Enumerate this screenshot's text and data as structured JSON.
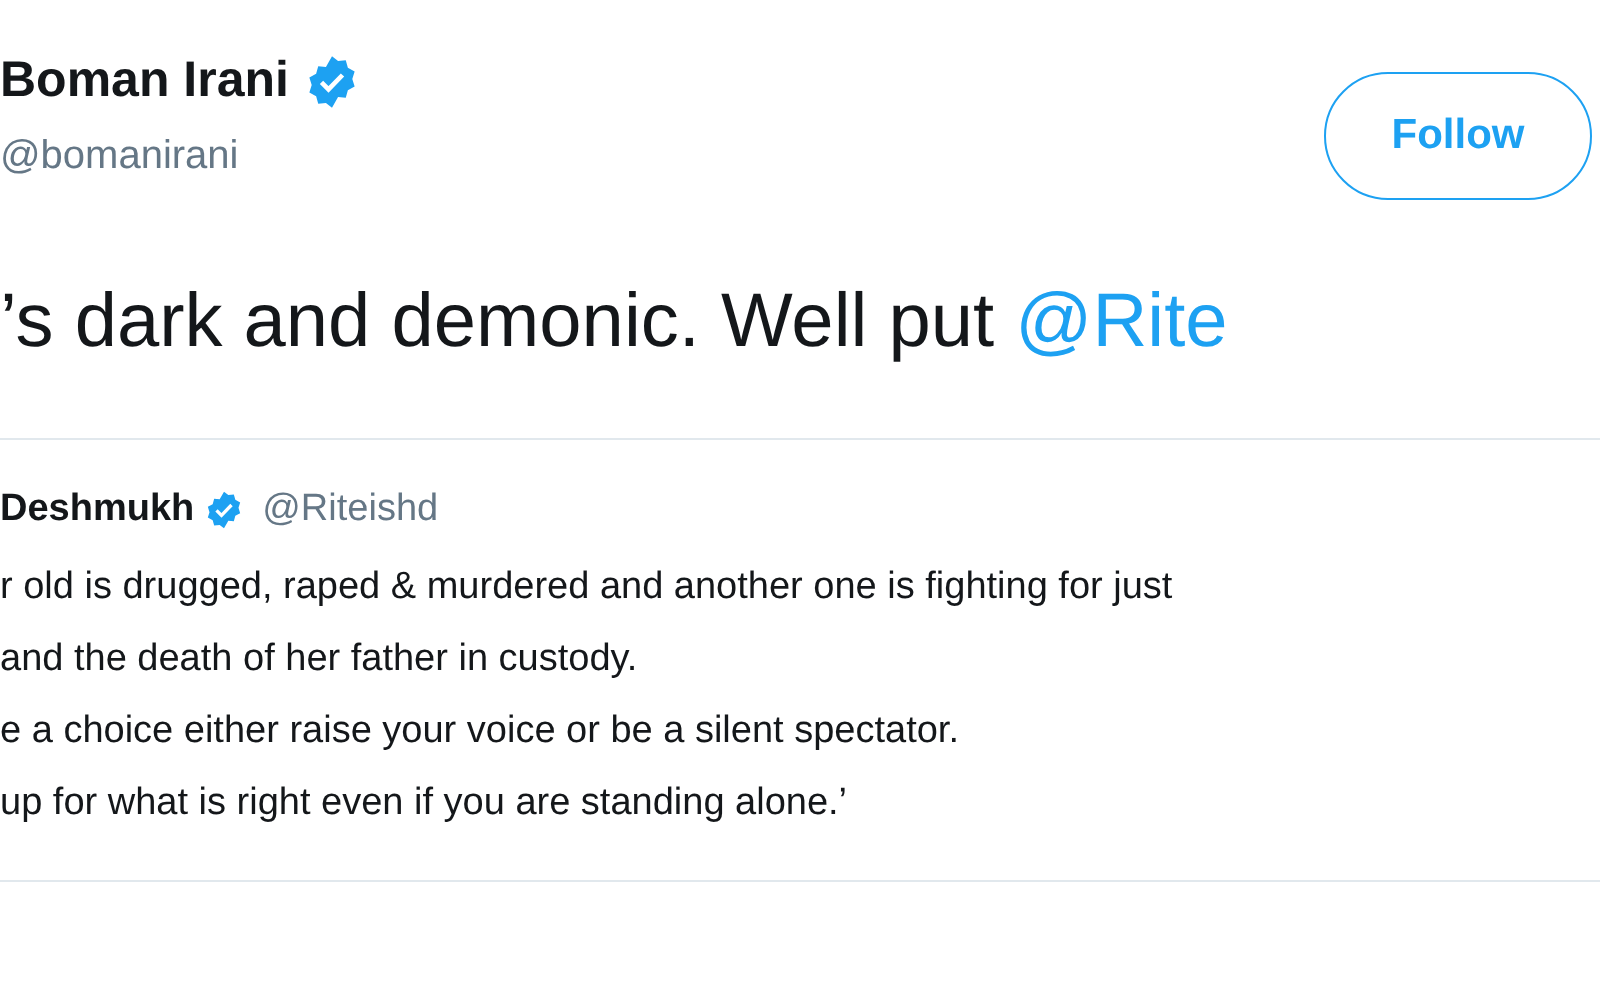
{
  "author": {
    "name": "Boman Irani",
    "verified": true,
    "handle": "@bomanirani"
  },
  "follow_button": {
    "label": "Follow"
  },
  "tweet": {
    "text": "’s dark and demonic. Well put ",
    "mention": "@Rite"
  },
  "quoted_tweet": {
    "name": "Deshmukh",
    "verified": true,
    "handle": "@Riteishd",
    "lines": [
      "r old is drugged, raped & murdered and another one is fighting for just",
      "and the death of her father in custody.",
      "e a choice either raise your voice or be a silent spectator.",
      "up for what is right even if you are standing alone.’"
    ]
  }
}
